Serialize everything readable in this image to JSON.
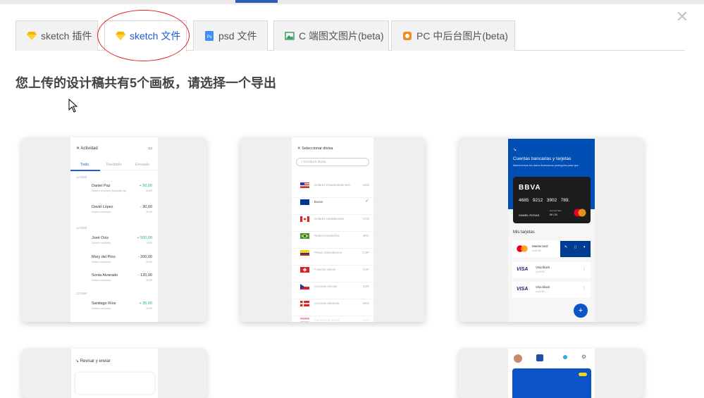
{
  "tabs": [
    {
      "label": "sketch 插件",
      "icon": "sketch-diamond-icon"
    },
    {
      "label": "sketch 文件",
      "icon": "sketch-diamond-icon",
      "active": true
    },
    {
      "label": "psd 文件",
      "icon": "photoshop-icon"
    },
    {
      "label": "C 端图文图片(beta)",
      "icon": "image-icon"
    },
    {
      "label": "PC 中后台图片(beta)",
      "icon": "pc-image-icon"
    }
  ],
  "heading": "您上传的设计稿共有5个画板，请选择一个导出",
  "boards": {
    "actividad": {
      "title": "Actividad",
      "tabs": [
        "Todo",
        "Recibido",
        "Enviado"
      ],
      "groups": [
        {
          "date": "12 ENE",
          "rows": [
            {
              "name": "Daniel Paz",
              "sub": "Dinero recibido (lavanderia)",
              "amount": "+ 50,00",
              "cur": "EUR",
              "positive": true
            },
            {
              "name": "David López",
              "sub": "Dinero enviado",
              "amount": "- 30,00",
              "cur": "EUR",
              "positive": false
            }
          ]
        },
        {
          "date": "12 ENE",
          "rows": [
            {
              "name": "José Oviz",
              "sub": "Dinero recibido",
              "amount": "+ 500,00",
              "cur": "USD",
              "positive": true
            },
            {
              "name": "Mary del Pino",
              "sub": "Dinero enviado",
              "amount": "- 200,00",
              "cur": "EUR",
              "positive": false
            },
            {
              "name": "Sonia Alvarado",
              "sub": "Dinero enviado",
              "amount": "- 120,00",
              "cur": "EUR",
              "positive": false
            }
          ]
        },
        {
          "date": "12 ENE",
          "rows": [
            {
              "name": "Santiago Ríos",
              "sub": "Dinero recibido",
              "amount": "+ 35,00",
              "cur": "EUR",
              "positive": true
            }
          ]
        }
      ]
    },
    "divisa": {
      "title": "Seleccionar divisa",
      "search_placeholder": "Introducir divisa",
      "items": [
        {
          "name": "Dólares estadounidenses",
          "code": "USD",
          "flag": "us"
        },
        {
          "name": "Euros",
          "code": "",
          "flag": "eu",
          "selected": true
        },
        {
          "name": "Dólares canadienses",
          "code": "CAD",
          "flag": "ca"
        },
        {
          "name": "Reales brasileños",
          "code": "BRL",
          "flag": "br"
        },
        {
          "name": "Pesos colombianos",
          "code": "COP",
          "flag": "co"
        },
        {
          "name": "Francos suizos",
          "code": "CHF",
          "flag": "ch"
        },
        {
          "name": "Coronas checas",
          "code": "CZK",
          "flag": "cz"
        },
        {
          "name": "Coronas danesas",
          "code": "DKK",
          "flag": "dk"
        },
        {
          "name": "Florines húngaros",
          "code": "HUF",
          "flag": "hu"
        }
      ]
    },
    "cuentas": {
      "title": "Cuentas bancarias y tarjetas",
      "subtitle": "Mantenemos tus datos financieros protegidos para que",
      "bank": "BBVA",
      "card_number": [
        "4685",
        "9212",
        "3902",
        "789."
      ],
      "holder": "DANIEL ROSAS",
      "expiry_label": "Expired date",
      "expiry": "09 / 24",
      "section": "Mis tarjetas",
      "cards": [
        {
          "brand": "Mastercard",
          "num": "••••8765"
        },
        {
          "brand": "Visa black",
          "num": "••••3762",
          "logo": "VISA"
        },
        {
          "brand": "Visa black",
          "num": "••••3762",
          "logo": "VISA"
        }
      ],
      "fab": "+"
    },
    "revisar": {
      "title": "Revisar y enviar"
    }
  },
  "colors": {
    "accent": "#1f5bd4",
    "bbva": "#004fb5",
    "positive": "#27b36a"
  }
}
